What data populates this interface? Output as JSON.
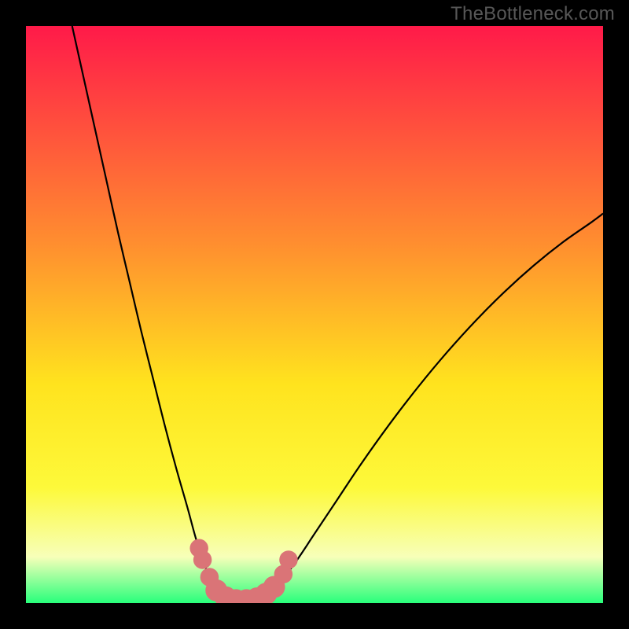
{
  "watermark": "TheBottleneck.com",
  "colors": {
    "gradient_top": "#ff1a49",
    "gradient_mid1": "#ff8f2f",
    "gradient_mid2": "#ffe31e",
    "gradient_mid3": "#fdf93a",
    "gradient_pale": "#f7ffb9",
    "gradient_bottom": "#28ff7b",
    "curve": "#000000",
    "bead": "#da7477",
    "frame": "#000000"
  },
  "chart_data": {
    "type": "line",
    "title": "",
    "xlabel": "",
    "ylabel": "",
    "xlim": [
      0,
      100
    ],
    "ylim": [
      0,
      100
    ],
    "grid": false,
    "legend": false,
    "annotations": [],
    "series": [
      {
        "name": "left-branch",
        "x": [
          8.0,
          10.0,
          12.0,
          14.0,
          16.0,
          18.0,
          20.0,
          22.0,
          24.0,
          26.0,
          28.0,
          29.5,
          31.0,
          32.5,
          34.0
        ],
        "values": [
          100.0,
          91.0,
          82.0,
          73.0,
          64.0,
          55.5,
          47.0,
          39.0,
          31.0,
          23.5,
          16.5,
          11.0,
          6.5,
          3.0,
          1.0
        ]
      },
      {
        "name": "trough",
        "x": [
          34.0,
          35.5,
          37.0,
          38.5,
          40.0,
          41.5
        ],
        "values": [
          1.0,
          0.4,
          0.2,
          0.2,
          0.4,
          1.0
        ]
      },
      {
        "name": "right-branch",
        "x": [
          41.5,
          44.0,
          47.0,
          50.0,
          54.0,
          58.0,
          63.0,
          68.0,
          73.0,
          78.0,
          83.0,
          88.0,
          93.0,
          98.0,
          100.0
        ],
        "values": [
          1.0,
          3.5,
          7.5,
          12.0,
          18.0,
          24.0,
          31.0,
          37.5,
          43.5,
          49.0,
          54.0,
          58.5,
          62.5,
          66.0,
          67.5
        ]
      }
    ],
    "beads": {
      "name": "highlight-region",
      "points": [
        {
          "x": 30.0,
          "y": 9.5,
          "r": 1.6
        },
        {
          "x": 30.6,
          "y": 7.5,
          "r": 1.6
        },
        {
          "x": 31.8,
          "y": 4.5,
          "r": 1.6
        },
        {
          "x": 33.0,
          "y": 2.2,
          "r": 1.9
        },
        {
          "x": 34.6,
          "y": 1.0,
          "r": 1.9
        },
        {
          "x": 36.4,
          "y": 0.5,
          "r": 1.9
        },
        {
          "x": 38.2,
          "y": 0.5,
          "r": 1.9
        },
        {
          "x": 40.0,
          "y": 0.8,
          "r": 1.9
        },
        {
          "x": 41.6,
          "y": 1.6,
          "r": 1.9
        },
        {
          "x": 43.0,
          "y": 2.8,
          "r": 1.9
        },
        {
          "x": 44.6,
          "y": 5.0,
          "r": 1.6
        },
        {
          "x": 45.5,
          "y": 7.5,
          "r": 1.6
        }
      ]
    }
  }
}
